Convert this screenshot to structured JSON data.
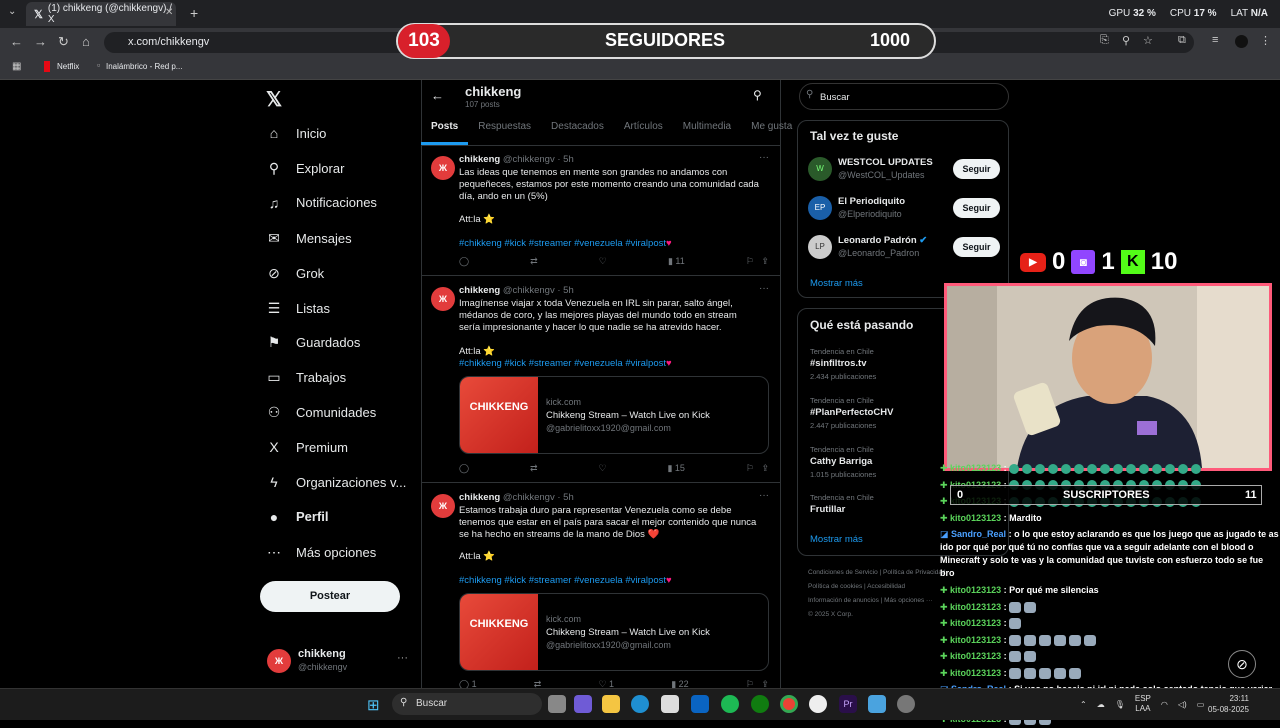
{
  "browser": {
    "tab_title": "(1) chikkeng (@chikkengv) / X",
    "url": "x.com/chikkengv",
    "bookmarks": [
      "Netflix",
      "Inalámbrico - Red p..."
    ],
    "hw_stats": {
      "gpu_label": "GPU",
      "gpu_value": "32 %",
      "cpu_label": "CPU",
      "cpu_value": "17 %",
      "lat_label": "LAT",
      "lat_value": "N/A"
    }
  },
  "overlay": {
    "followers_count": "103",
    "followers_label": "SEGUIDORES",
    "followers_goal": "1000",
    "youtube_count": "0",
    "twitch_count": "1",
    "kick_count": "10",
    "subs_current": "0",
    "subs_label": "SUSCRIPTORES",
    "subs_goal": "11"
  },
  "sidebar": {
    "items": [
      {
        "label": "Inicio",
        "icon": "home-icon",
        "glyph": "⌂"
      },
      {
        "label": "Explorar",
        "icon": "search-icon",
        "glyph": "⚲"
      },
      {
        "label": "Notificaciones",
        "icon": "bell-icon",
        "glyph": "♫"
      },
      {
        "label": "Mensajes",
        "icon": "mail-icon",
        "glyph": "✉"
      },
      {
        "label": "Grok",
        "icon": "grok-icon",
        "glyph": "⊘"
      },
      {
        "label": "Listas",
        "icon": "list-icon",
        "glyph": "☰"
      },
      {
        "label": "Guardados",
        "icon": "bookmark-icon",
        "glyph": "⚑"
      },
      {
        "label": "Trabajos",
        "icon": "briefcase-icon",
        "glyph": "▭"
      },
      {
        "label": "Comunidades",
        "icon": "people-icon",
        "glyph": "⚇"
      },
      {
        "label": "Premium",
        "icon": "x-premium-icon",
        "glyph": "X"
      },
      {
        "label": "Organizaciones v...",
        "icon": "bolt-icon",
        "glyph": "ϟ"
      },
      {
        "label": "Perfil",
        "icon": "profile-icon",
        "glyph": "●"
      },
      {
        "label": "Más opciones",
        "icon": "more-icon",
        "glyph": "⋯"
      }
    ],
    "post_button": "Postear",
    "user_name": "chikkeng",
    "user_handle": "@chikkengv"
  },
  "feed": {
    "name": "chikkeng",
    "post_count": "107 posts",
    "tabs": [
      "Posts",
      "Respuestas",
      "Destacados",
      "Artículos",
      "Multimedia",
      "Me gusta"
    ],
    "posts": [
      {
        "author": "chikkeng",
        "meta": "@chikkengv · 5h",
        "text": "Las ideas que tenemos en mente son grandes no andamos con pequeñeces, estamos por este momento creando una comunidad cada día, ando en un (5%)",
        "att": "Att:la ⭐",
        "tags": "#chikkeng #kick #streamer #venezuela #viralpost",
        "views": "11"
      },
      {
        "author": "chikkeng",
        "meta": "@chikkengv · 5h",
        "text": "Imagínense viajar x toda Venezuela en IRL sin parar, salto ángel, médanos de coro, y las mejores playas del mundo todo en stream sería impresionante y hacer lo que nadie se ha atrevido hacer.",
        "att": "Att:la ⭐",
        "tags": "#chikkeng #kick #streamer #venezuela #viralpost",
        "card_domain": "kick.com",
        "card_title": "Chikkeng Stream – Watch Live on Kick",
        "card_email": "@gabrielitoxx1920@gmail.com",
        "card_thumb": "CHIKKENG",
        "views": "15"
      },
      {
        "author": "chikkeng",
        "meta": "@chikkengv · 5h",
        "text": "Estamos trabaja duro para representar Venezuela como se debe tenemos que estar en el país para sacar el mejor contenido que nunca se ha hecho en streams de la mano de Dios ❤️",
        "att": "Att:la ⭐",
        "tags": "#chikkeng #kick #streamer #venezuela #viralpost",
        "card_domain": "kick.com",
        "card_title": "Chikkeng Stream – Watch Live on Kick",
        "card_email": "@gabrielitoxx1920@gmail.com",
        "card_thumb": "CHIKKENG",
        "replies": "1",
        "likes": "1",
        "views": "22"
      }
    ]
  },
  "right": {
    "search_placeholder": "Buscar",
    "suggest_title": "Tal vez te guste",
    "suggestions": [
      {
        "name": "WESTCOL UPDATES",
        "handle": "@WestCOL_Updates",
        "button": "Seguir"
      },
      {
        "name": "El Periodiquito",
        "handle": "@Elperiodiquito",
        "button": "Seguir"
      },
      {
        "name": "Leonardo Padrón",
        "handle": "@Leonardo_Padron",
        "button": "Seguir"
      }
    ],
    "show_more": "Mostrar más",
    "trends_title": "Qué está pasando",
    "trends": [
      {
        "context": "Tendencia en Chile",
        "name": "#sinfiltros.tv",
        "posts": "2.434 publicaciones"
      },
      {
        "context": "Tendencia en Chile",
        "name": "#PlanPerfectoCHV",
        "posts": "2.447 publicaciones"
      },
      {
        "context": "Tendencia en Chile",
        "name": "Cathy Barriga",
        "posts": "1.015 publicaciones"
      },
      {
        "context": "Tendencia en Chile",
        "name": "Frutillar",
        "posts": ""
      }
    ],
    "trends_more": "Mostrar más",
    "footer": [
      "Condiciones de Servicio",
      "Política de Privacidad",
      "Política de cookies",
      "Accesibilidad",
      "Información de anuncios",
      "Más opciones ···",
      "© 2025 X Corp."
    ]
  },
  "chat": [
    {
      "user": "kito0123123",
      "sep": ":",
      "text": "",
      "emotes": 15,
      "style": "green"
    },
    {
      "user": "kito0123123",
      "sep": ":",
      "text": "",
      "emotes": 15,
      "style": "green"
    },
    {
      "user": "kito0123123",
      "sep": ":",
      "text": "",
      "emotes": 15,
      "style": "green"
    },
    {
      "user": "kito0123123",
      "sep": ":",
      "text": "Mardito",
      "emotes": 0,
      "style": "green"
    },
    {
      "user": "Sandro_Real",
      "sep": ":",
      "text": "o lo que estoy aclarando es que los juego que as jugado te as ido por qué por qué tú no confías que va a seguir adelante con el blood o Minecraft y solo te vas y la comunidad que tuviste con esfuerzo todo se fue bro",
      "emotes": 0,
      "style": "blue"
    },
    {
      "user": "kito0123123",
      "sep": ":",
      "text": "Por qué me silencias",
      "emotes": 0,
      "style": "green"
    },
    {
      "user": "kito0123123",
      "sep": ":",
      "text": "",
      "emotes": 2,
      "style": "green"
    },
    {
      "user": "kito0123123",
      "sep": ":",
      "text": "",
      "emotes": 1,
      "style": "green"
    },
    {
      "user": "kito0123123",
      "sep": ":",
      "text": "",
      "emotes": 6,
      "style": "green"
    },
    {
      "user": "kito0123123",
      "sep": ":",
      "text": "",
      "emotes": 2,
      "style": "green"
    },
    {
      "user": "kito0123123",
      "sep": ":",
      "text": "",
      "emotes": 5,
      "style": "green"
    },
    {
      "user": "Sandro_Real",
      "sep": ":",
      "text": "Si vos no haceis ni irl ni nada solo sentado teneis que variar no solo es hablar popo",
      "emotes": 0,
      "style": "blue"
    },
    {
      "user": "kito0123123",
      "sep": ":",
      "text": "",
      "emotes": 3,
      "style": "green"
    }
  ],
  "taskbar": {
    "search_placeholder": "Buscar",
    "lang": "ESP",
    "lang2": "LAA",
    "time": "23:11",
    "date": "05-08-2025"
  }
}
